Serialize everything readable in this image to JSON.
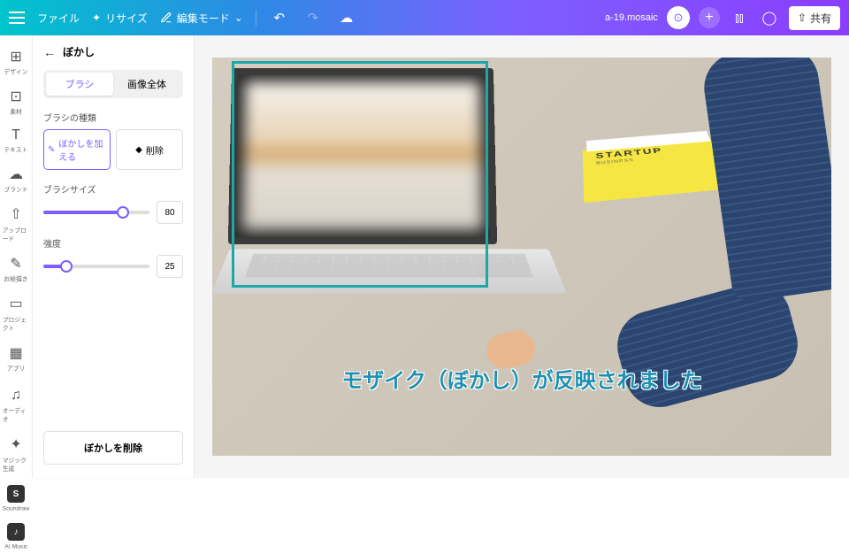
{
  "topbar": {
    "file": "ファイル",
    "resize": "リサイズ",
    "edit_mode": "編集モード",
    "doc_name": "a-19.mosaic",
    "share": "共有"
  },
  "rail": {
    "items": [
      {
        "icon": "⊞",
        "label": "デザイン"
      },
      {
        "icon": "⊡",
        "label": "素材"
      },
      {
        "icon": "T",
        "label": "テキスト"
      },
      {
        "icon": "☁",
        "label": "ブランド"
      },
      {
        "icon": "⇧",
        "label": "アップロード"
      },
      {
        "icon": "✎",
        "label": "お絵描き"
      },
      {
        "icon": "▭",
        "label": "プロジェクト"
      },
      {
        "icon": "▦",
        "label": "アプリ"
      }
    ],
    "extra": [
      {
        "icon": "♫",
        "label": "オーディオ"
      },
      {
        "icon": "✦",
        "label": "マジック生成"
      },
      {
        "icon": "S",
        "label": "Soundraw",
        "dark": true
      },
      {
        "icon": "♪",
        "label": "AI Music",
        "dark": true
      }
    ]
  },
  "panel": {
    "title": "ぼかし",
    "tabs": {
      "brush": "ブラシ",
      "whole": "画像全体"
    },
    "brush_type_label": "ブラシの種類",
    "add_blur": "ぼかしを加える",
    "erase": "削除",
    "brush_size_label": "ブラシサイズ",
    "brush_size_value": "80",
    "intensity_label": "強度",
    "intensity_value": "25",
    "remove_blur": "ぼかしを削除"
  },
  "canvas": {
    "book_title": "STARTUP",
    "book_sub": "BUSINESS",
    "caption": "モザイク（ぼかし）が反映されました"
  }
}
